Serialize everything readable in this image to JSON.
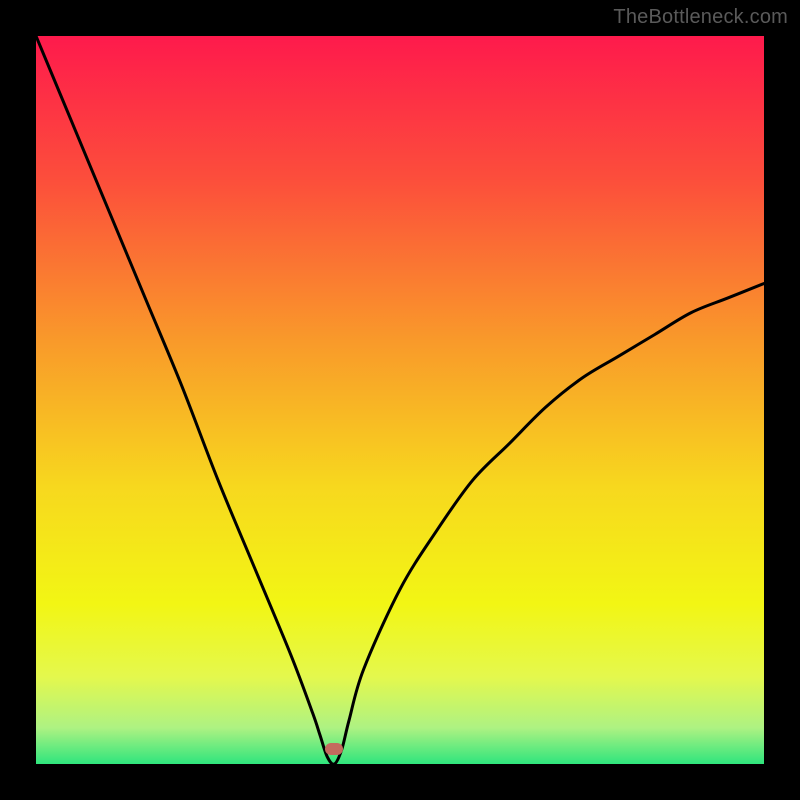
{
  "watermark": {
    "text": "TheBottleneck.com"
  },
  "chart_data": {
    "type": "line",
    "title": "",
    "xlabel": "",
    "ylabel": "",
    "xlim": [
      0,
      100
    ],
    "ylim": [
      0,
      100
    ],
    "grid": false,
    "legend": false,
    "marker": {
      "x": 41,
      "y": 2,
      "color": "#c46a5e"
    },
    "series": [
      {
        "name": "bottleneck-curve",
        "x": [
          0,
          5,
          10,
          15,
          20,
          25,
          30,
          35,
          38,
          39,
          40,
          41,
          42,
          43,
          45,
          50,
          55,
          60,
          65,
          70,
          75,
          80,
          85,
          90,
          95,
          100
        ],
        "values": [
          100,
          88,
          76,
          64,
          52,
          39,
          27,
          15,
          7,
          4,
          1,
          0,
          2,
          6,
          13,
          24,
          32,
          39,
          44,
          49,
          53,
          56,
          59,
          62,
          64,
          66
        ]
      }
    ],
    "background_gradient": {
      "type": "vertical",
      "stops": [
        {
          "pos": 0.0,
          "color": "#fe1a4c"
        },
        {
          "pos": 0.2,
          "color": "#fc4f3b"
        },
        {
          "pos": 0.42,
          "color": "#f99a2a"
        },
        {
          "pos": 0.62,
          "color": "#f7d81e"
        },
        {
          "pos": 0.78,
          "color": "#f2f614"
        },
        {
          "pos": 0.88,
          "color": "#e4f84d"
        },
        {
          "pos": 0.95,
          "color": "#aef282"
        },
        {
          "pos": 1.0,
          "color": "#2fe57d"
        }
      ]
    }
  }
}
